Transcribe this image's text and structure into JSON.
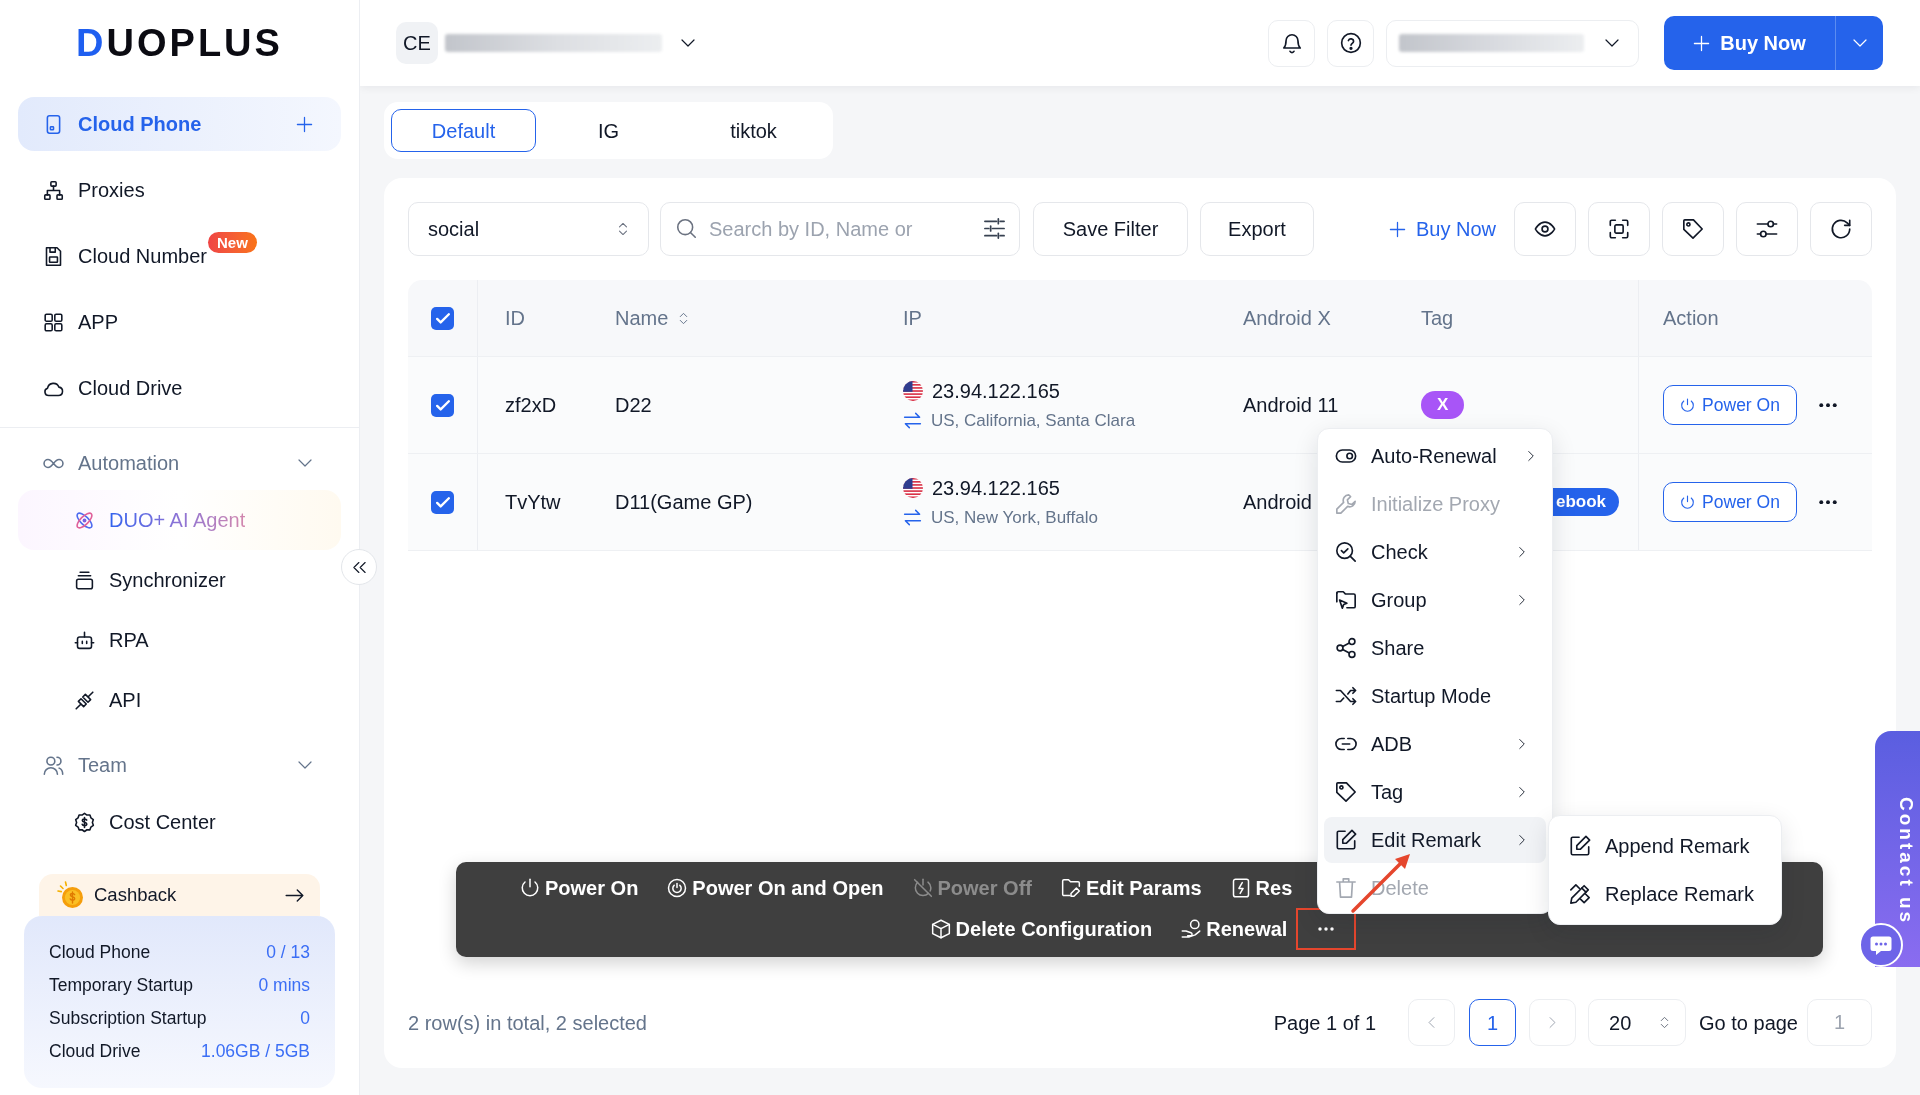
{
  "sidebar": {
    "logo": "DUOPLUS",
    "main_items": [
      {
        "label": "Cloud Phone",
        "selected": true,
        "add_button": true
      },
      {
        "label": "Proxies",
        "selected": false
      },
      {
        "label": "Cloud Number",
        "selected": false,
        "badge": "New"
      },
      {
        "label": "APP",
        "selected": false
      },
      {
        "label": "Cloud Drive",
        "selected": false
      }
    ],
    "groups": [
      {
        "label": "Automation",
        "expanded": true,
        "children": [
          {
            "label": "DUO+ AI Agent",
            "kind": "featured",
            "selected": false
          },
          {
            "label": "Synchronizer",
            "kind": "item",
            "selected": false
          },
          {
            "label": "RPA",
            "kind": "item",
            "selected": false
          },
          {
            "label": "API",
            "kind": "item",
            "selected": false
          }
        ]
      },
      {
        "label": "Team",
        "expanded": true,
        "children": [
          {
            "label": "Cost Center",
            "kind": "item",
            "selected": false
          }
        ]
      }
    ],
    "cashback": {
      "label": "Cashback"
    },
    "usage": [
      {
        "label": "Cloud Phone",
        "value": "0 / 13"
      },
      {
        "label": "Temporary Startup",
        "value": "0 mins"
      },
      {
        "label": "Subscription Startup",
        "value": "0"
      },
      {
        "label": "Cloud Drive",
        "value": "1.06GB / 5GB"
      }
    ]
  },
  "header": {
    "team": {
      "avatar": "CE",
      "name_redacted": true
    },
    "account": {
      "name_redacted": true
    },
    "buy_button": "Buy Now"
  },
  "tabs": [
    {
      "label": "Default",
      "selected": true
    },
    {
      "label": "IG",
      "selected": false
    },
    {
      "label": "tiktok",
      "selected": false
    }
  ],
  "toolbar": {
    "group_select": "social",
    "search": {
      "placeholder": "Search by ID, Name or"
    },
    "buttons": [
      "Save Filter",
      "Export"
    ],
    "buy_link": "Buy Now"
  },
  "table": {
    "select_all": true,
    "columns": [
      {
        "label": "ID"
      },
      {
        "label": "Name",
        "sortable": true
      },
      {
        "label": "IP"
      },
      {
        "label": "Android X"
      },
      {
        "label": "Tag"
      },
      {
        "label": "Action"
      }
    ],
    "rows": [
      {
        "checked": true,
        "id": "zf2xD",
        "name": "D22",
        "ip": "23.94.122.165",
        "location": "US, California, Santa Clara",
        "android": "Android 11",
        "tag": {
          "text": "X",
          "color": "#a855f7"
        },
        "action": "Power On"
      },
      {
        "checked": true,
        "id": "TvYtw",
        "name": "D11(Game GP)",
        "ip": "23.94.122.165",
        "location": "US, New York, Buffalo",
        "android": "Android",
        "tag": {
          "text": "ebook",
          "color": "#2563eb",
          "cut_left": true
        },
        "action": "Power On"
      }
    ]
  },
  "context_menu": {
    "items": [
      {
        "label": "Auto-Renewal",
        "submenu": true,
        "disabled": false,
        "highlighted": false
      },
      {
        "label": "Initialize Proxy",
        "submenu": false,
        "disabled": true,
        "highlighted": false
      },
      {
        "label": "Check",
        "submenu": true,
        "disabled": false,
        "highlighted": false
      },
      {
        "label": "Group",
        "submenu": true,
        "disabled": false,
        "highlighted": false
      },
      {
        "label": "Share",
        "submenu": false,
        "disabled": false,
        "highlighted": false
      },
      {
        "label": "Startup Mode",
        "submenu": false,
        "disabled": false,
        "highlighted": false
      },
      {
        "label": "ADB",
        "submenu": true,
        "disabled": false,
        "highlighted": false
      },
      {
        "label": "Tag",
        "submenu": true,
        "disabled": false,
        "highlighted": false
      },
      {
        "label": "Edit Remark",
        "submenu": true,
        "disabled": false,
        "highlighted": true,
        "children": [
          {
            "label": "Append Remark"
          },
          {
            "label": "Replace Remark"
          }
        ]
      },
      {
        "label": "Delete",
        "submenu": false,
        "disabled": true,
        "highlighted": false
      }
    ]
  },
  "bulk_actions": {
    "lines": [
      {
        "actions": [
          {
            "kind": "action",
            "label": "Power On",
            "disabled": false
          },
          {
            "kind": "action",
            "label": "Power On and Open",
            "disabled": false
          },
          {
            "kind": "action",
            "label": "Power Off",
            "disabled": true
          },
          {
            "kind": "action",
            "label": "Edit Params",
            "disabled": false
          },
          {
            "kind": "action",
            "label": "Res",
            "disabled": false
          }
        ]
      },
      {
        "actions": [
          {
            "kind": "action",
            "label": "Delete Configuration",
            "disabled": false
          },
          {
            "kind": "action",
            "label": "Renewal",
            "disabled": false
          },
          {
            "kind": "more",
            "annotated": true
          }
        ]
      }
    ]
  },
  "pagination": {
    "summary": "2 row(s) in total, 2 selected",
    "page_info": "Page 1 of 1",
    "prev_disabled": true,
    "pages": [
      {
        "label": "1",
        "selected": true
      }
    ],
    "next_disabled": true,
    "page_size": "20",
    "goto_label": "Go to page",
    "goto_placeholder": "1"
  },
  "contact_tab": {
    "label": "Contact us"
  }
}
